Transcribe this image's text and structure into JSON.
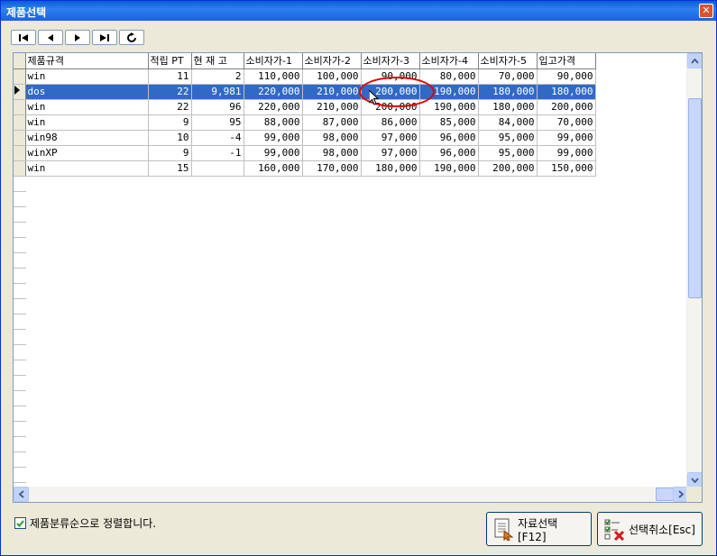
{
  "window": {
    "title": "제품선택",
    "close_glyph": "✕"
  },
  "navigator": {
    "buttons": [
      {
        "name": "first-record-icon"
      },
      {
        "name": "prior-record-icon"
      },
      {
        "name": "next-record-icon"
      },
      {
        "name": "last-record-icon"
      },
      {
        "name": "refresh-icon"
      }
    ]
  },
  "grid": {
    "columns": [
      "제품규격",
      "적립 PT",
      "현 재 고",
      "소비자가-1",
      "소비자가-2",
      "소비자가-3",
      "소비자가-4",
      "소비자가-5",
      "입고가격"
    ],
    "rows": [
      [
        "win",
        "11",
        "2",
        "110,000",
        "100,000",
        "90,000",
        "80,000",
        "70,000",
        "90,000"
      ],
      [
        "dos",
        "22",
        "9,981",
        "220,000",
        "210,000",
        "200,000",
        "190,000",
        "180,000",
        "180,000"
      ],
      [
        "win",
        "22",
        "96",
        "220,000",
        "210,000",
        "200,000",
        "190,000",
        "180,000",
        "200,000"
      ],
      [
        "win",
        "9",
        "95",
        "88,000",
        "87,000",
        "86,000",
        "85,000",
        "84,000",
        "70,000"
      ],
      [
        "win98",
        "10",
        "-4",
        "99,000",
        "98,000",
        "97,000",
        "96,000",
        "95,000",
        "99,000"
      ],
      [
        "winXP",
        "9",
        "-1",
        "99,000",
        "98,000",
        "97,000",
        "96,000",
        "95,000",
        "99,000"
      ],
      [
        "win",
        "15",
        "",
        "160,000",
        "170,000",
        "180,000",
        "190,000",
        "200,000",
        "150,000"
      ]
    ],
    "selected_row": 1
  },
  "footer": {
    "sort_checkbox_label": "제품분류순으로 정렬합니다.",
    "sort_checked": true,
    "select_button_label": "자료선택[F12]",
    "cancel_button_label": "선택취소[Esc]"
  },
  "colors": {
    "selection": "#316ac5",
    "highlight_circle": "#e00000",
    "title_bar": "#0a5ed6"
  }
}
